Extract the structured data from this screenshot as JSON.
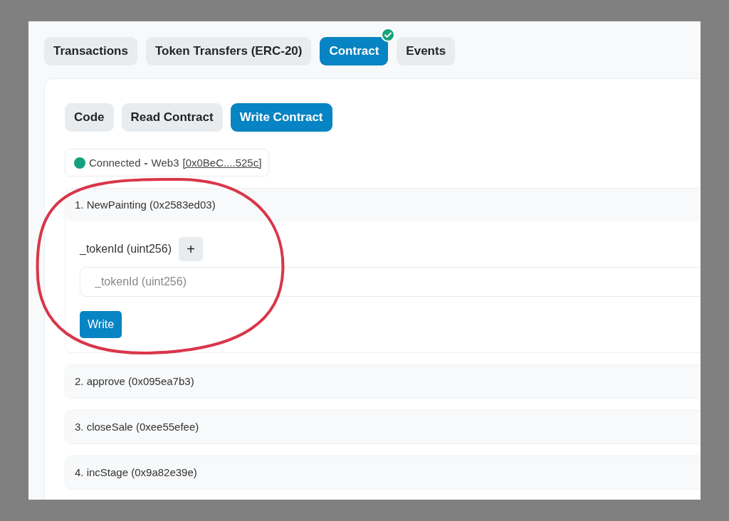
{
  "tabs": [
    {
      "label": "Transactions",
      "selected": false,
      "verified": false
    },
    {
      "label": "Token Transfers (ERC-20)",
      "selected": false,
      "verified": false
    },
    {
      "label": "Contract",
      "selected": true,
      "verified": true
    },
    {
      "label": "Events",
      "selected": false,
      "verified": false
    }
  ],
  "subtabs": [
    {
      "label": "Code",
      "selected": false
    },
    {
      "label": "Read Contract",
      "selected": false
    },
    {
      "label": "Write Contract",
      "selected": true
    }
  ],
  "connection": {
    "connected": true,
    "status": "Connected",
    "separator": "-",
    "provider": "Web3",
    "address": "[0x0BeC....525c]"
  },
  "functions": [
    {
      "title": "1. NewPainting (0x2583ed03)",
      "expanded": true,
      "inputs": [
        {
          "label": "_tokenId (uint256)",
          "add": "+",
          "placeholder": "_tokenId (uint256)"
        }
      ],
      "button": "Write"
    },
    {
      "title": "2. approve (0x095ea7b3)",
      "expanded": false
    },
    {
      "title": "3. closeSale (0xee55efee)",
      "expanded": false
    },
    {
      "title": "4. incStage (0x9a82e39e)",
      "expanded": false
    }
  ]
}
